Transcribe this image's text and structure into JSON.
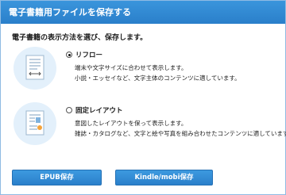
{
  "window": {
    "title": "電子書籍用ファイルを保存する"
  },
  "instruction": "電子書籍の表示方法を選び、保存します。",
  "options": [
    {
      "label": "リフロー",
      "selected": true,
      "icon": "reflow-document-icon",
      "description": [
        "端末や文字サイズに合わせて表示します。",
        "小説・エッセイなど、文字主体のコンテンツに適しています。"
      ]
    },
    {
      "label": "固定レイアウト",
      "selected": false,
      "icon": "fixed-layout-document-icon",
      "description": [
        "意図したレイアウトを保って表示します。",
        "雑誌・カタログなど、文字と絵や写真を組み合わせたコンテンツに適しています。"
      ]
    }
  ],
  "buttons": {
    "epub": "EPUB保存",
    "kindle": "Kindle/mobi保存"
  },
  "colors": {
    "accent": "#2a7fca",
    "titlebar": "#3a95dc",
    "icon_circle": "#e3f0fb"
  }
}
